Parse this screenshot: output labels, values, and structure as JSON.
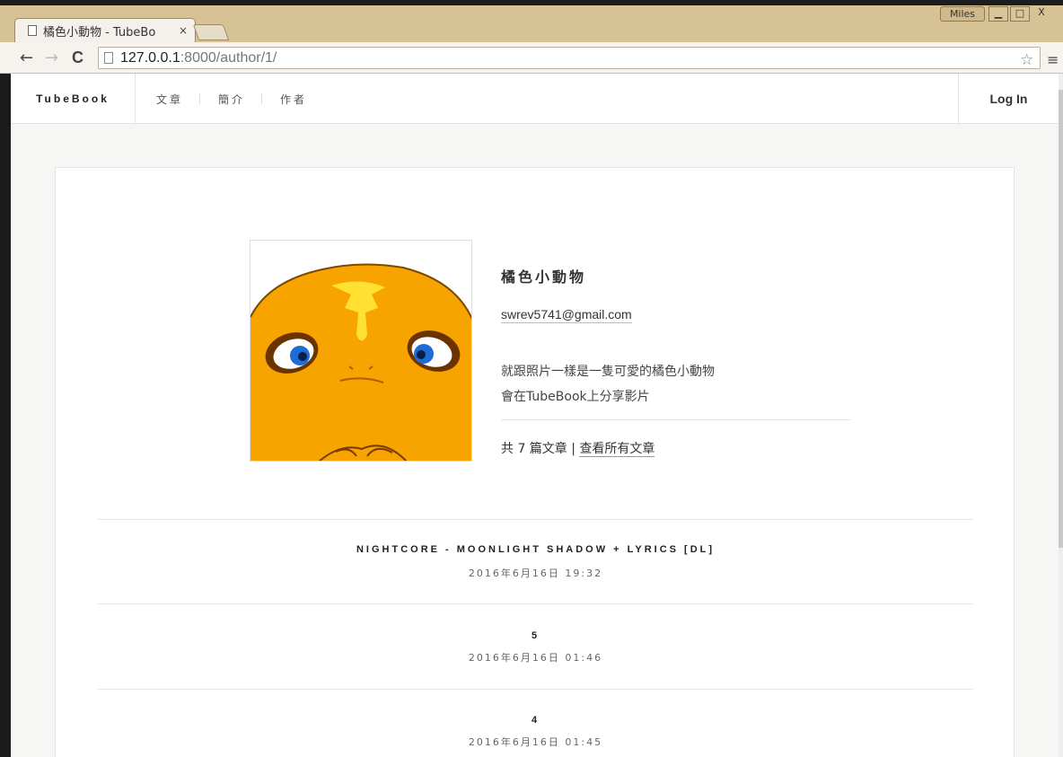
{
  "browser": {
    "tab_title": "橘色小動物 - TubeBo",
    "tab_close": "×",
    "profile_name": "Miles",
    "window_minimize": "▁",
    "window_maximize": "□",
    "window_close": "X",
    "url_host": "127.0.0.1",
    "url_path": ":8000/author/1/",
    "back": "←",
    "forward": "→",
    "reload": "C",
    "bookmark_star": "☆",
    "menu": "≡"
  },
  "navbar": {
    "brand": "TubeBook",
    "links": [
      "文章",
      "簡介",
      "作者"
    ],
    "login": "Log In"
  },
  "author": {
    "name": "橘色小動物",
    "email": "swrev5741@gmail.com",
    "bio_line1": "就跟照片一樣是一隻可愛的橘色小動物",
    "bio_line2": "會在TubeBook上分享影片",
    "count_text": "共 7 篇文章 | ",
    "all_posts_link": "查看所有文章"
  },
  "posts": [
    {
      "title": "NIGHTCORE - MOONLIGHT SHADOW + LYRICS [DL]",
      "date": "2016年6月16日 19:32"
    },
    {
      "title": "5",
      "date": "2016年6月16日 01:46"
    },
    {
      "title": "4",
      "date": "2016年6月16日 01:45"
    }
  ]
}
